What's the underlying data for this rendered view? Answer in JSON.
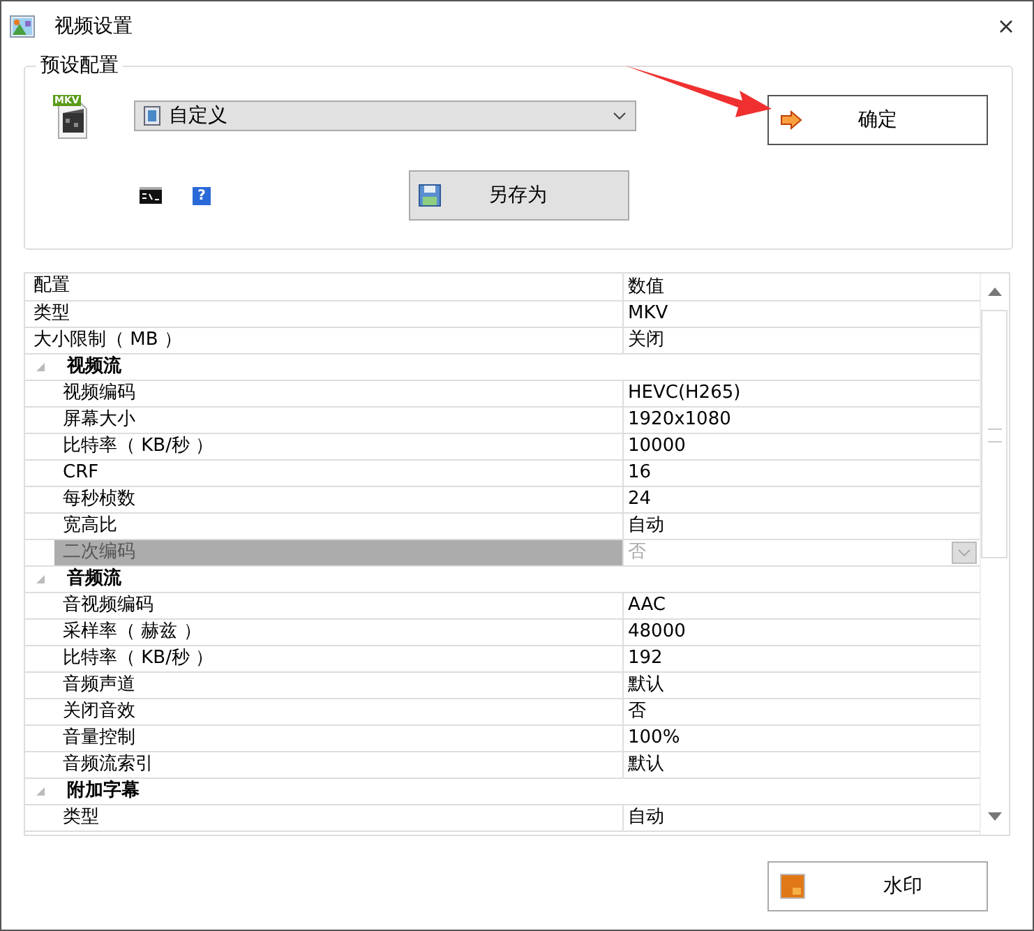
{
  "window": {
    "title": "视频设置"
  },
  "preset": {
    "legend": "预设配置",
    "file_icon_label": "MKV",
    "dropdown": {
      "value": "自定义"
    },
    "help_icon": "?",
    "save_as_button": "另存为",
    "ok_button": "确定"
  },
  "table": {
    "columns": [
      "配置",
      "数值"
    ],
    "rows": [
      {
        "kind": "row",
        "name": "类型",
        "value": "MKV",
        "selected": false
      },
      {
        "kind": "row",
        "name": "大小限制（ MB ）",
        "value": "关闭",
        "selected": false
      },
      {
        "kind": "group",
        "name": "视频流",
        "expanded": true,
        "children": [
          {
            "kind": "row",
            "name": "视频编码",
            "value": "HEVC(H265)",
            "selected": false
          },
          {
            "kind": "row",
            "name": "屏幕大小",
            "value": "1920x1080",
            "selected": false
          },
          {
            "kind": "row",
            "name": "比特率（ KB/秒 ）",
            "value": "10000",
            "selected": false
          },
          {
            "kind": "row",
            "name": "CRF",
            "value": "16",
            "selected": false
          },
          {
            "kind": "row",
            "name": "每秒桢数",
            "value": "24",
            "selected": false
          },
          {
            "kind": "row",
            "name": "宽高比",
            "value": "自动",
            "selected": false
          },
          {
            "kind": "row",
            "name": "二次编码",
            "value": "否",
            "selected": true
          }
        ]
      },
      {
        "kind": "group",
        "name": "音频流",
        "expanded": true,
        "children": [
          {
            "kind": "row",
            "name": "音视频编码",
            "value": "AAC",
            "selected": false
          },
          {
            "kind": "row",
            "name": "采样率（ 赫兹 ）",
            "value": "48000",
            "selected": false
          },
          {
            "kind": "row",
            "name": "比特率（ KB/秒 ）",
            "value": "192",
            "selected": false
          },
          {
            "kind": "row",
            "name": "音频声道",
            "value": "默认",
            "selected": false
          },
          {
            "kind": "row",
            "name": "关闭音效",
            "value": "否",
            "selected": false
          },
          {
            "kind": "row",
            "name": "音量控制",
            "value": "100%",
            "selected": false
          },
          {
            "kind": "row",
            "name": "音频流索引",
            "value": "默认",
            "selected": false
          }
        ]
      },
      {
        "kind": "group",
        "name": "附加字幕",
        "expanded": true,
        "children": [
          {
            "kind": "row",
            "name": "类型",
            "value": "自动",
            "selected": false
          }
        ]
      }
    ]
  },
  "watermark_button": "水印"
}
